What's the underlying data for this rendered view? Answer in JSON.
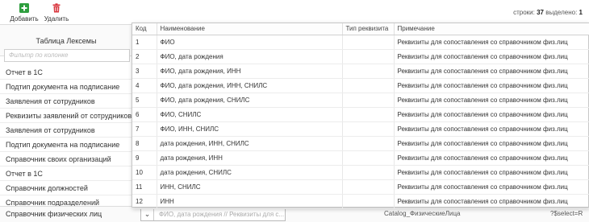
{
  "toolbar": {
    "add_label": "Добавить",
    "delete_label": "Удалить",
    "rows_label": "строки:",
    "rows_count": "37",
    "selected_label": "выделено:",
    "selected_count": "1",
    "add_color": "#2e9e3e",
    "delete_color": "#d9363e"
  },
  "left_panel": {
    "header": "Таблица Лексемы",
    "filter_placeholder": "Фильтр по колонке",
    "rows": [
      "Отчет в 1С",
      "Подтип документа на подписание",
      "Заявления от сотрудников",
      "Реквизиты заявлений от сотрудников",
      "Заявления от сотрудников",
      "Подтип документа на подписание",
      "Справочник своих организаций",
      "Отчет в 1С",
      "Справочник должностей",
      "Справочник подразделений"
    ]
  },
  "bottom_row": {
    "first_cell": "Справочник физических лиц",
    "combo_value": "ФИО, дата рождения // Реквизиты для с...",
    "catalog": "Catalog_ФизическиеЛица",
    "select_fragment": "?$select=R"
  },
  "dropdown": {
    "columns": [
      "Код",
      "Наименование",
      "Тип реквизита",
      "Примечание"
    ],
    "rows": [
      {
        "code": "1",
        "name": "ФИО",
        "type": "",
        "note": "Реквизиты для сопоставления со справочником физ.лиц"
      },
      {
        "code": "2",
        "name": "ФИО, дата рождения",
        "type": "",
        "note": "Реквизиты для сопоставления со справочником физ.лиц"
      },
      {
        "code": "3",
        "name": "ФИО, дата рождения, ИНН",
        "type": "",
        "note": "Реквизиты для сопоставления со справочником физ.лиц"
      },
      {
        "code": "4",
        "name": "ФИО, дата рождения, ИНН, СНИЛС",
        "type": "",
        "note": "Реквизиты для сопоставления со справочником физ.лиц"
      },
      {
        "code": "5",
        "name": "ФИО, дата рождения, СНИЛС",
        "type": "",
        "note": "Реквизиты для сопоставления со справочником физ.лиц"
      },
      {
        "code": "6",
        "name": "ФИО, СНИЛС",
        "type": "",
        "note": "Реквизиты для сопоставления со справочником физ.лиц"
      },
      {
        "code": "7",
        "name": "ФИО, ИНН, СНИЛС",
        "type": "",
        "note": "Реквизиты для сопоставления со справочником физ.лиц"
      },
      {
        "code": "8",
        "name": "дата рождения, ИНН, СНИЛС",
        "type": "",
        "note": "Реквизиты для сопоставления со справочником физ.лиц"
      },
      {
        "code": "9",
        "name": "дата рождения, ИНН",
        "type": "",
        "note": "Реквизиты для сопоставления со справочником физ.лиц"
      },
      {
        "code": "10",
        "name": "дата рождения, СНИЛС",
        "type": "",
        "note": "Реквизиты для сопоставления со справочником физ.лиц"
      },
      {
        "code": "11",
        "name": "ИНН, СНИЛС",
        "type": "",
        "note": "Реквизиты для сопоставления со справочником физ.лиц"
      },
      {
        "code": "12",
        "name": "ИНН",
        "type": "",
        "note": "Реквизиты для сопоставления со справочником физ.лиц"
      }
    ]
  }
}
